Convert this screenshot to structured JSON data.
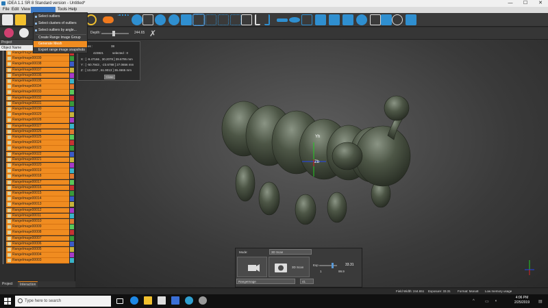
{
  "window": {
    "title": "iDEA 1.1 SR 8 Standard version - Untitled*",
    "minimize_glyph": "—",
    "maximize_glyph": "☐",
    "close_glyph": "✕"
  },
  "menubar": {
    "items": [
      "File",
      "Edit",
      "View",
      "",
      "Tools",
      "Help"
    ],
    "active_index": 3
  },
  "dropdown": {
    "items": [
      "Select outliers",
      "Select clusters of outliers",
      "Select outliers by angle...",
      "Create Range Image Group",
      "Generate Mesh",
      "Export range image snapshots"
    ],
    "highlighted_index": 4
  },
  "toolbar2": {
    "depth_label": "Depth:",
    "depth_value": "244.65",
    "depth_fraction": 0.45
  },
  "left_panel": {
    "title": "Project",
    "column_header": "Object Name",
    "rows": [
      "RangeImage00040",
      "RangeImage00039",
      "RangeImage00038",
      "RangeImage00037",
      "RangeImage00036",
      "RangeImage00035",
      "RangeImage00034",
      "RangeImage00033",
      "RangeImage00032",
      "RangeImage00031",
      "RangeImage00030",
      "RangeImage00029",
      "RangeImage00028",
      "RangeImage00027",
      "RangeImage00026",
      "RangeImage00025",
      "RangeImage00024",
      "RangeImage00023",
      "RangeImage00022",
      "RangeImage00021",
      "RangeImage00020",
      "RangeImage00019",
      "RangeImage00018",
      "RangeImage00017",
      "RangeImage00016",
      "RangeImage00015",
      "RangeImage00014",
      "RangeImage00013",
      "RangeImage00012",
      "RangeImage00011",
      "RangeImage00010",
      "RangeImage00009",
      "RangeImage00008",
      "RangeImage00007",
      "RangeImage00006",
      "RangeImage00005",
      "RangeImage00004",
      "RangeImage00003"
    ],
    "swatch_colors": [
      "#c83232",
      "#3a9a3a",
      "#3a5ac8",
      "#c8b43a",
      "#a83ac8",
      "#3ab4c8",
      "#e07830",
      "#5ac85a"
    ],
    "tabs": [
      "Project",
      "Interaction"
    ],
    "active_tab": 1
  },
  "info_panel": {
    "images_label": "Images :",
    "images_value": "38",
    "points_value": "423821",
    "selected_label": "selected : 0",
    "x_line": "X : [ -9.47166 , 30.2078 ]   39.6795 mm",
    "y_line": "Y : [ -50.7943 , -23.6788 ]   27.0656 mm",
    "z_line": "Z : [ 13.4347 , 61.9013 ]   36.4665 mm",
    "close_label": "Close"
  },
  "scan_panel": {
    "mode_label": "Mode:",
    "mode_value": "3D Scan",
    "scan_button_label": "3D Scan",
    "exp_label": "Exp",
    "exp_value": "33.31",
    "exp_min": "1",
    "exp_max": "99.9",
    "range_select_value": "RangeImage",
    "range_index": "41"
  },
  "axis_labels": {
    "y": "Yh",
    "z": "Zb"
  },
  "statusbar": {
    "field_width": "Field Width: 244.651",
    "exposure": "Exposure: 33.31",
    "format": "Format: Mono8",
    "memory": "Low memory usage"
  },
  "taskbar": {
    "search_placeholder": "Type here to search",
    "time": "4:06 PM",
    "date": "2/25/2019"
  },
  "colors": {
    "accent_orange": "#f08c20",
    "menu_blue": "#3a78c4",
    "mesh": "#4d5646"
  }
}
